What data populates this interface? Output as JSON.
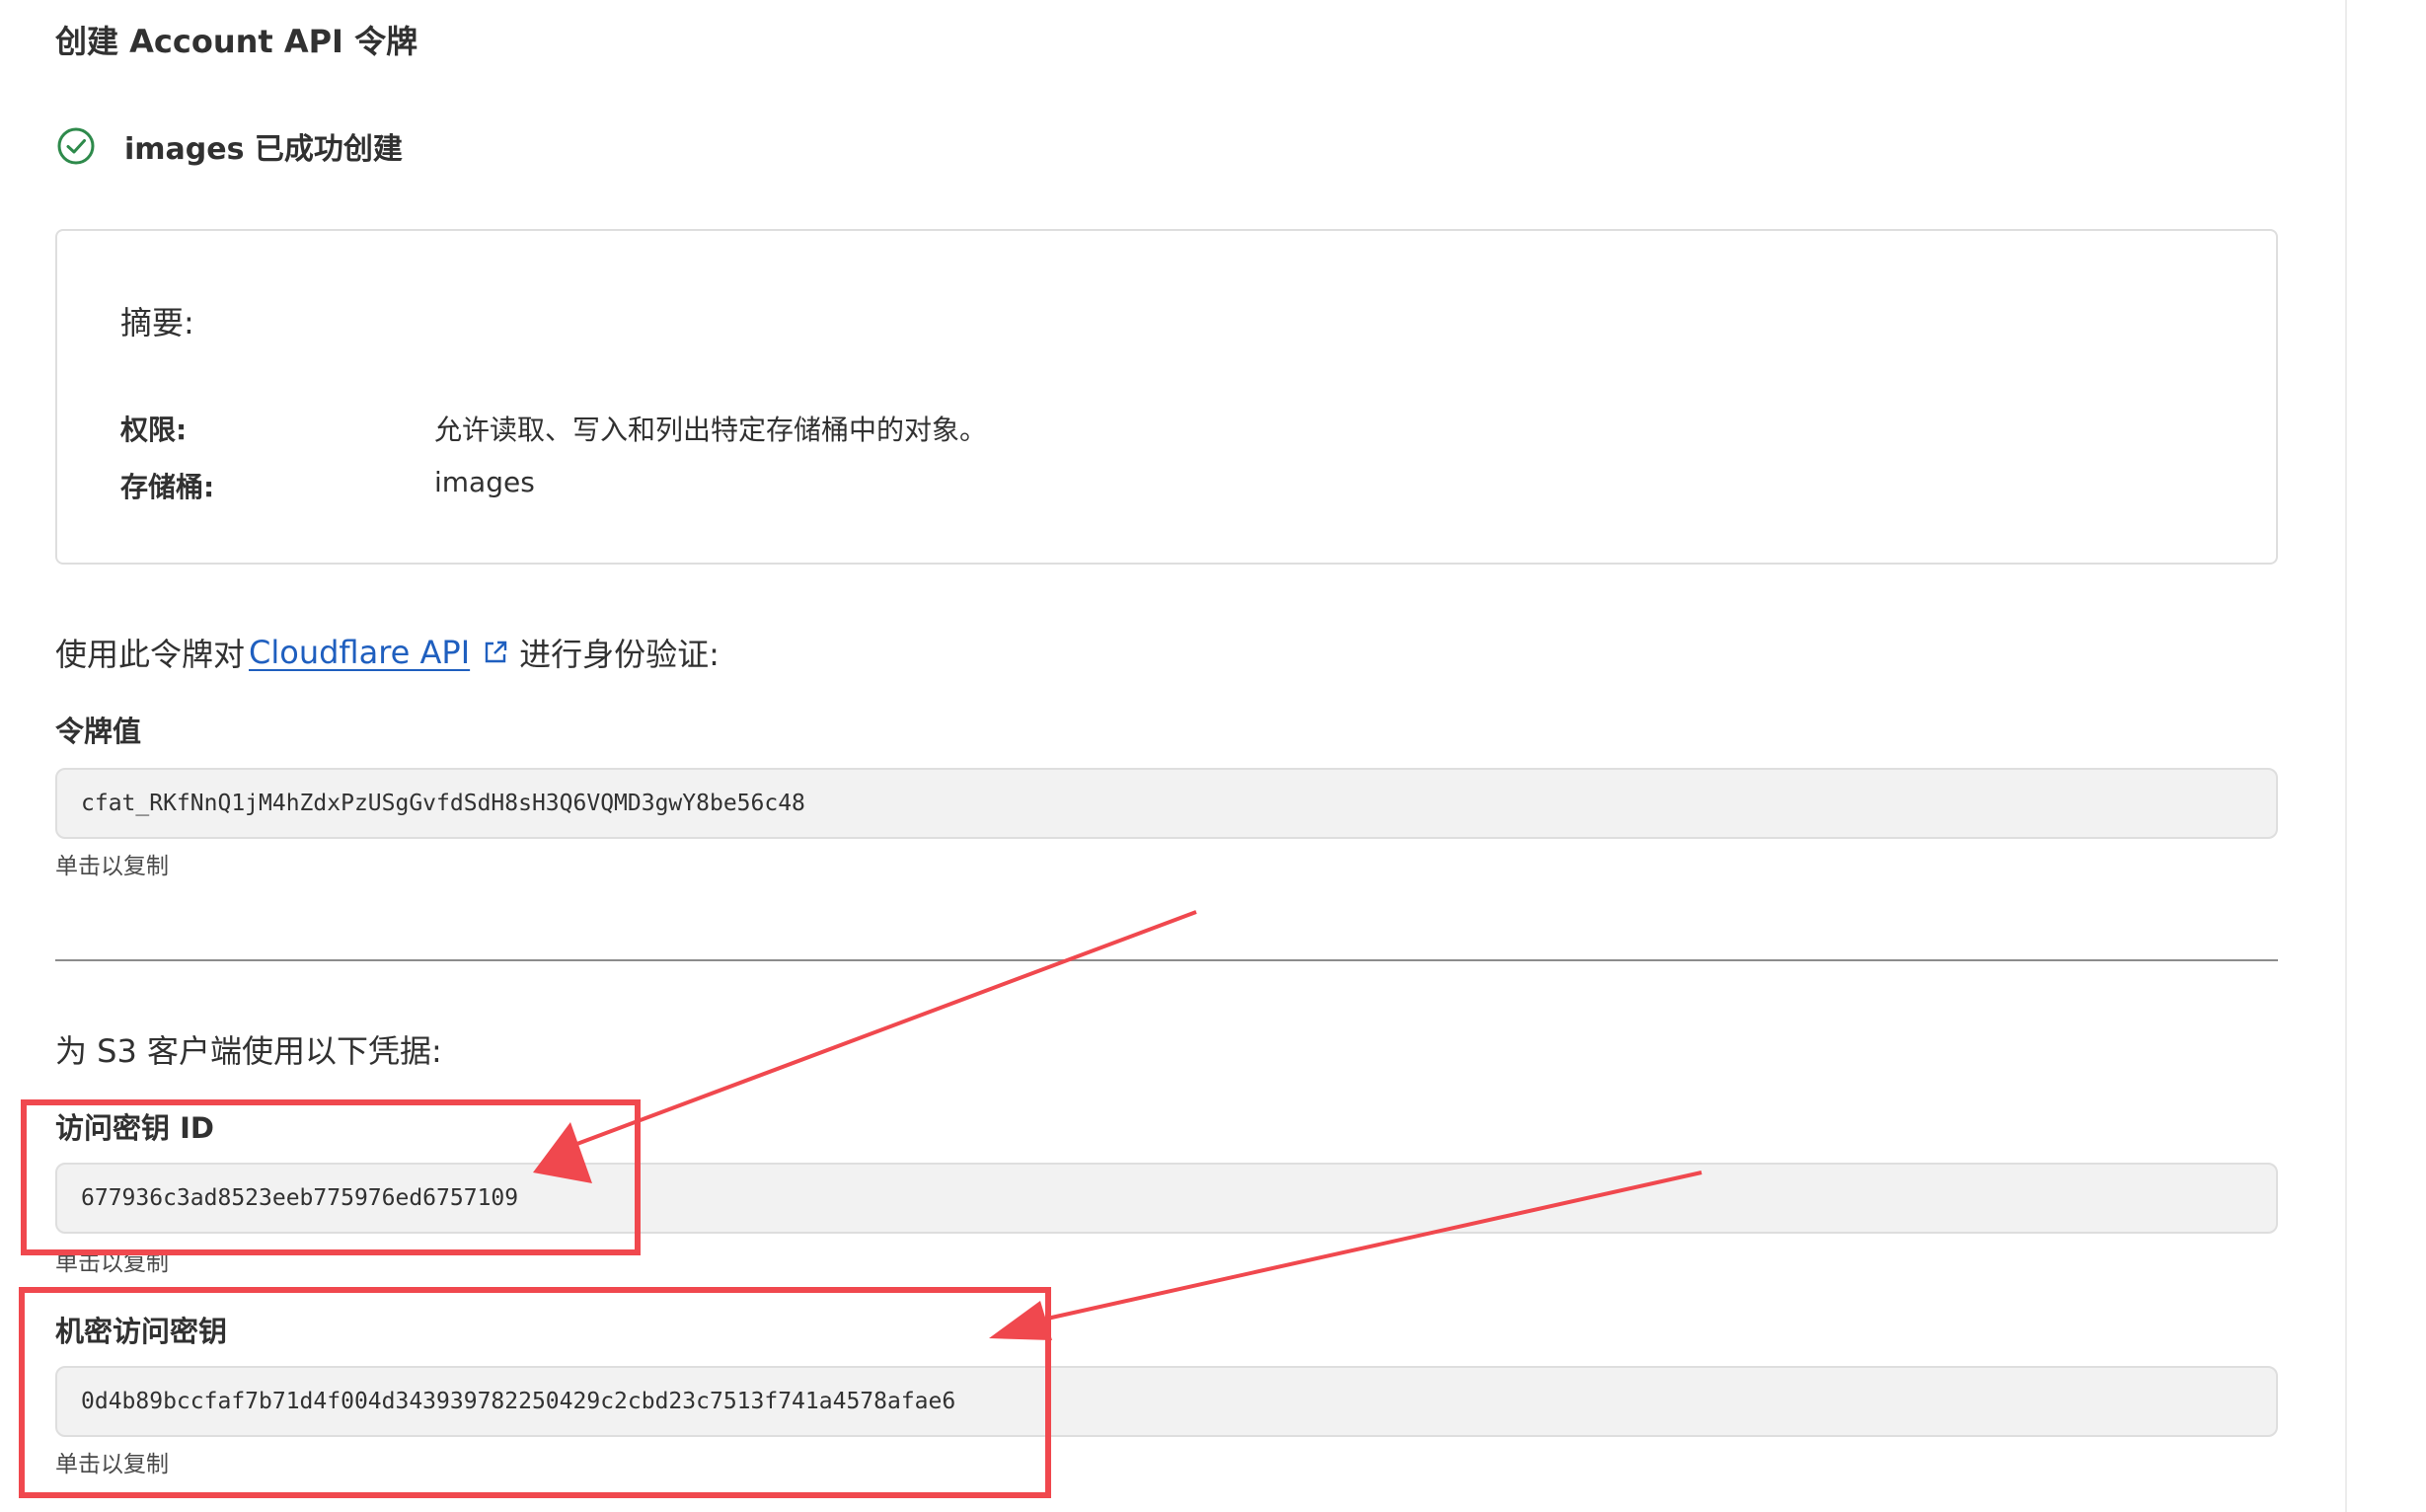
{
  "page": {
    "title": "创建 Account API 令牌"
  },
  "success": {
    "icon": "check-circle-icon",
    "message": "images 已成功创建"
  },
  "summary": {
    "heading": "摘要:",
    "rows": [
      {
        "label": "权限:",
        "value": "允许读取、写入和列出特定存储桶中的对象。"
      },
      {
        "label": "存储桶:",
        "value": "images"
      }
    ]
  },
  "auth": {
    "prefix": "使用此令牌对",
    "link_text": "Cloudflare API",
    "link_icon": "external-link-icon",
    "suffix": "进行身份验证:"
  },
  "token": {
    "label": "令牌值",
    "value": "cfat_RKfNnQ1jM4hZdxPzUSgGvfdSdH8sH3Q6VQMD3gwY8be56c48",
    "copy_hint": "单击以复制"
  },
  "s3": {
    "heading": "为 S3 客户端使用以下凭据:",
    "access_key": {
      "label": "访问密钥 ID",
      "value": "677936c3ad8523eeb775976ed6757109",
      "copy_hint": "单击以复制"
    },
    "secret_key": {
      "label": "机密访问密钥",
      "value": "0d4b89bccfaf7b71d4f004d343939782250429c2cbd23c7513f741a4578afae6",
      "copy_hint": "单击以复制"
    }
  },
  "colors": {
    "annotation_red": "#f0484e",
    "success_green": "#2e8a4b",
    "link_blue": "#1f5fbf"
  }
}
